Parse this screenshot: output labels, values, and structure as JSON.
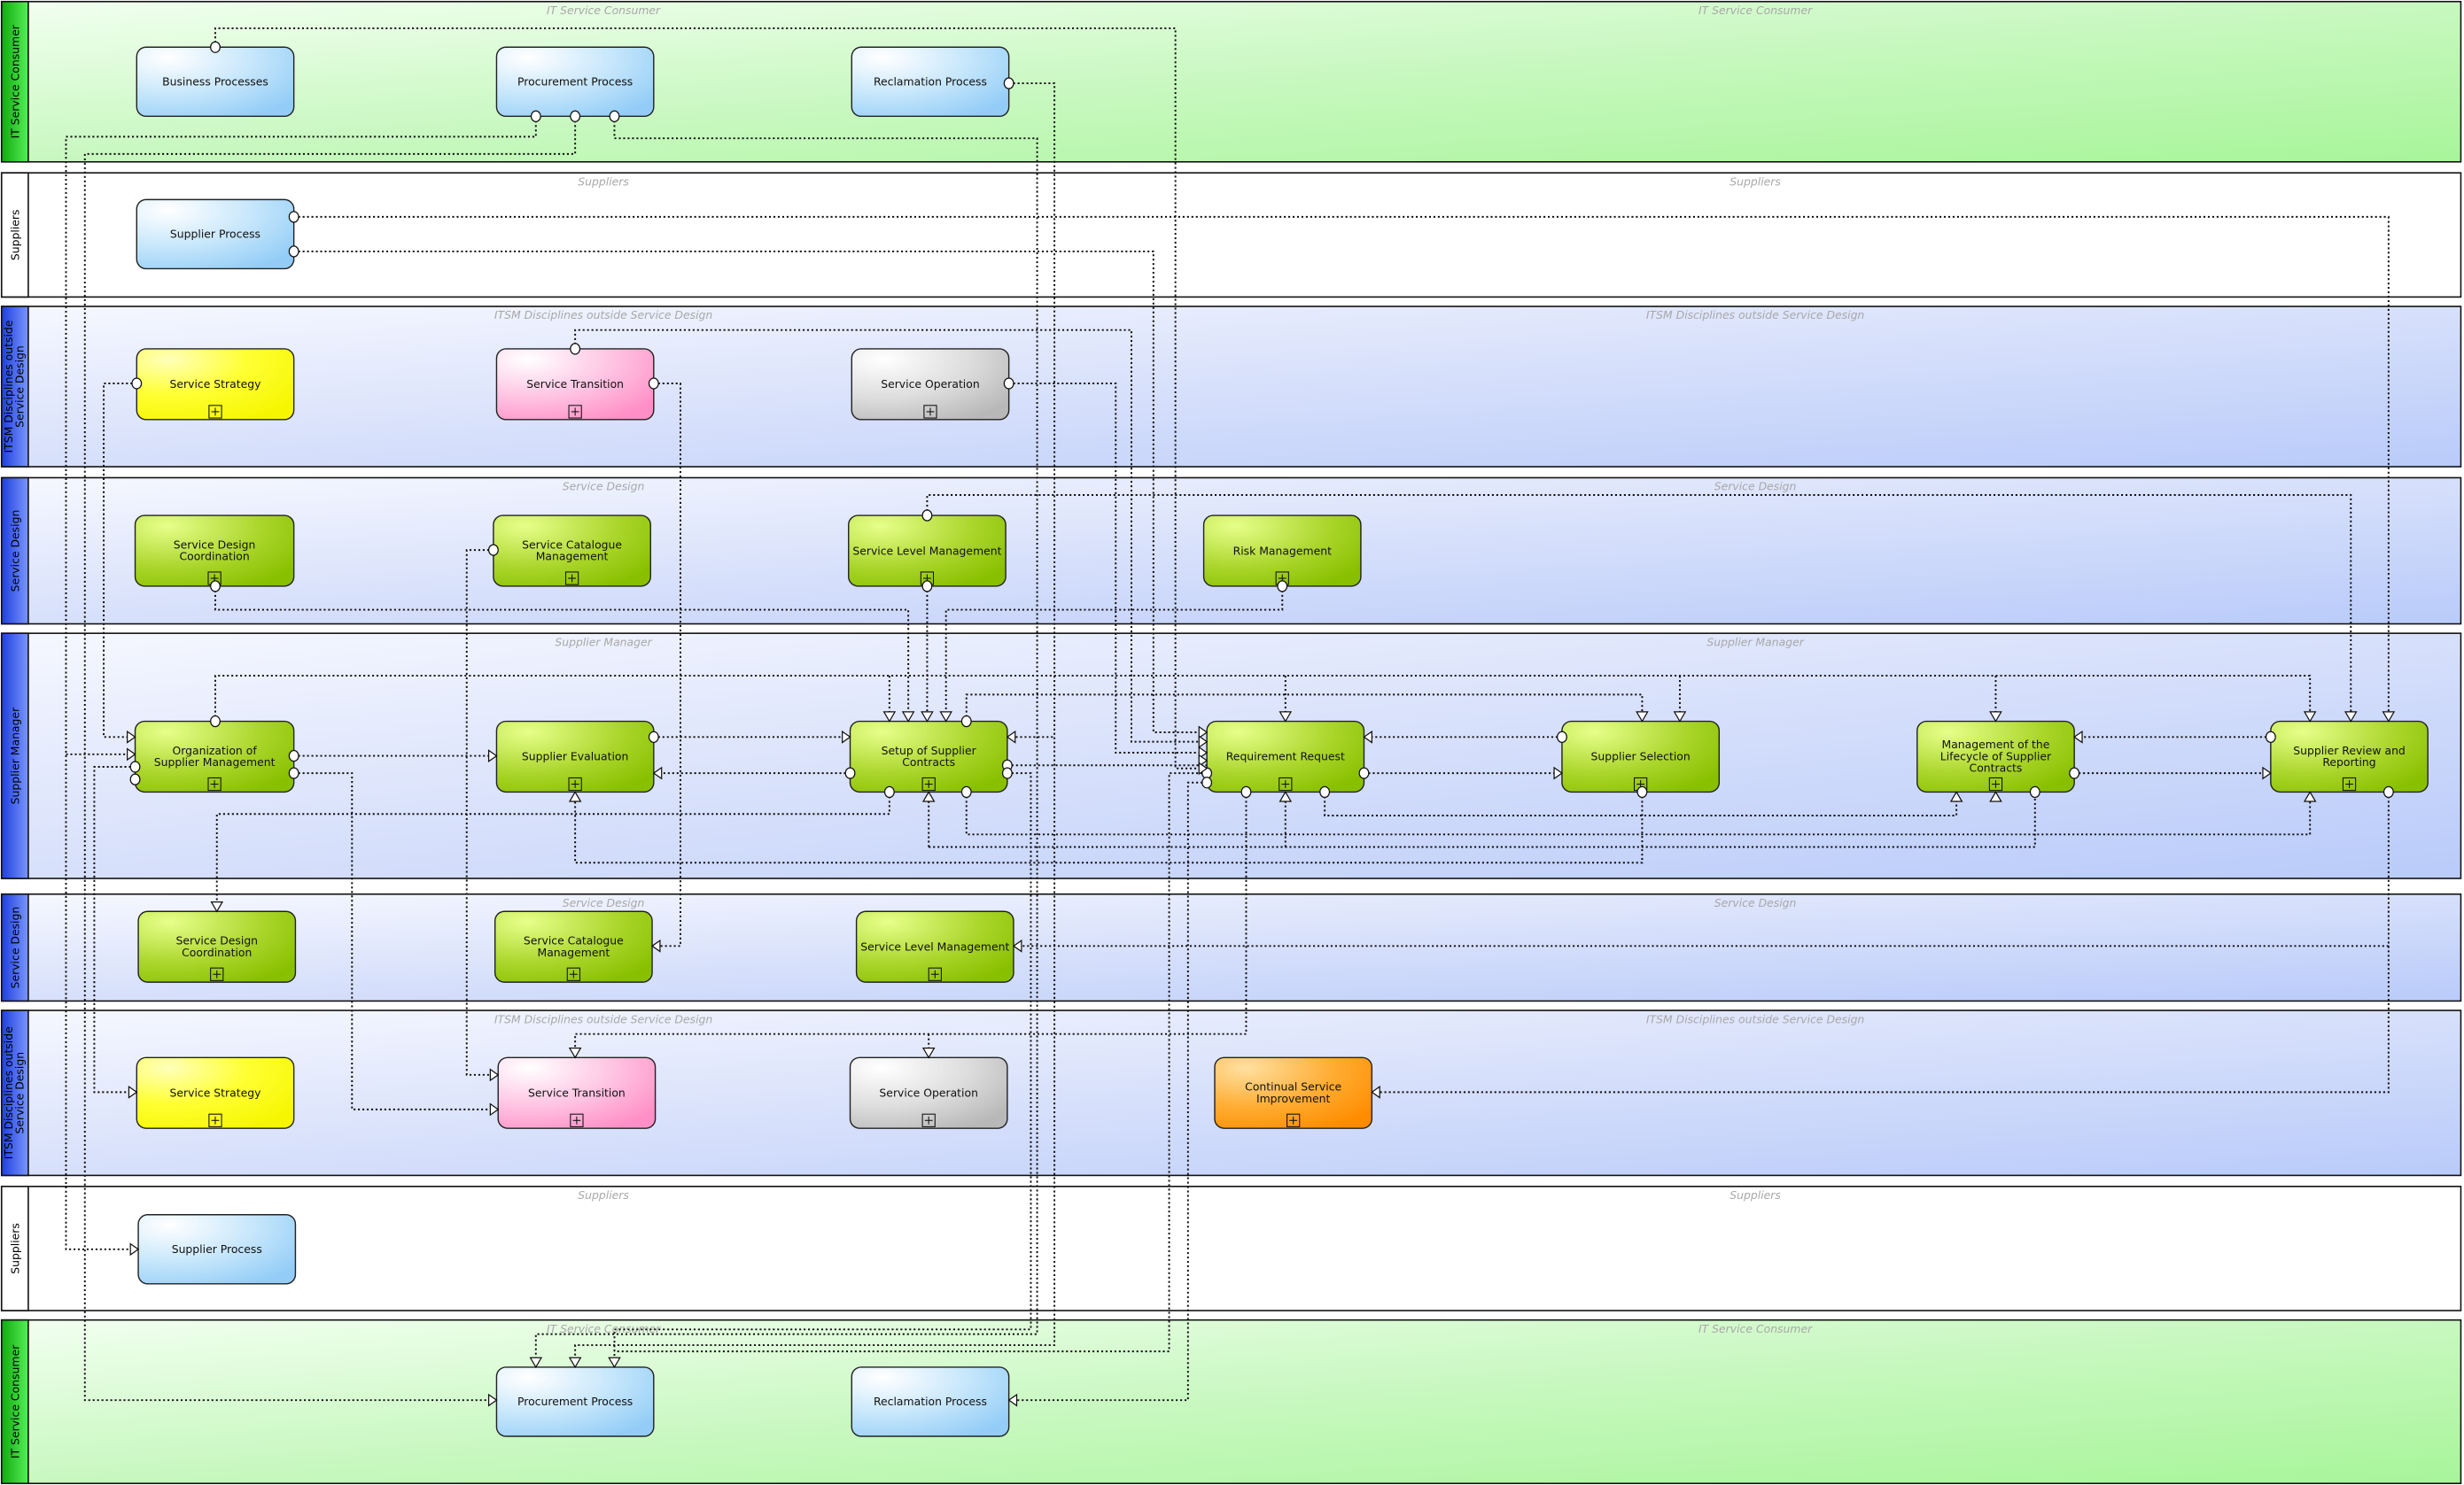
{
  "diagram": {
    "colors": {
      "consumer_lane": "#b3f5a8",
      "consumer_header": "#22cc22",
      "blue_lane": "#c2d2fb",
      "blue_header": "#3355ee",
      "white_lane": "#ffffff",
      "process_blue": "#a9d7f8",
      "green_activity": "#99cc00",
      "strategy_yellow": "#ffff00",
      "transition_pink": "#ff99cc",
      "operation_grey": "#c8c8c8",
      "csi_orange": "#ff9900"
    },
    "lanes": [
      {
        "id": "consumer-top",
        "label": "IT Service Consumer",
        "title": "IT Service Consumer",
        "title2": "IT Service Consumer"
      },
      {
        "id": "suppliers-top",
        "label": "Suppliers",
        "title": "Suppliers",
        "title2": "Suppliers"
      },
      {
        "id": "itsm-top",
        "label": "ITSM Disciplines outside Service Design",
        "title": "ITSM Disciplines outside Service Design",
        "title2": "ITSM Disciplines outside Service Design"
      },
      {
        "id": "sd-top",
        "label": "Service Design",
        "title": "Service Design",
        "title2": "Service Design"
      },
      {
        "id": "supplier-manager",
        "label": "Supplier Manager",
        "title": "Supplier Manager",
        "title2": "Supplier Manager"
      },
      {
        "id": "sd-bottom",
        "label": "Service Design",
        "title": "Service Design",
        "title2": "Service Design"
      },
      {
        "id": "itsm-bottom",
        "label": "ITSM Disciplines outside Service Design",
        "title": "ITSM Disciplines outside Service Design",
        "title2": "ITSM Disciplines outside Service Design"
      },
      {
        "id": "suppliers-bottom",
        "label": "Suppliers",
        "title": "Suppliers",
        "title2": "Suppliers"
      },
      {
        "id": "consumer-bottom",
        "label": "IT Service Consumer",
        "title": "IT Service Consumer",
        "title2": "IT Service Consumer"
      }
    ],
    "nodes": [
      {
        "id": "business-processes",
        "label": "Business Processes",
        "kind": "process"
      },
      {
        "id": "procurement-process-top",
        "label": "Procurement Process",
        "kind": "process"
      },
      {
        "id": "reclamation-process-top",
        "label": "Reclamation Process",
        "kind": "process"
      },
      {
        "id": "supplier-process-top",
        "label": "Supplier Process",
        "kind": "process"
      },
      {
        "id": "service-strategy-top",
        "label": "Service Strategy",
        "kind": "strategy"
      },
      {
        "id": "service-transition-top",
        "label": "Service Transition",
        "kind": "transition"
      },
      {
        "id": "service-operation-top",
        "label": "Service Operation",
        "kind": "operation"
      },
      {
        "id": "sdc-top",
        "label": "Service Design Coordination",
        "kind": "activity"
      },
      {
        "id": "scm-top",
        "label": "Service Catalogue Management",
        "kind": "activity"
      },
      {
        "id": "slm-top",
        "label": "Service Level Management",
        "kind": "activity"
      },
      {
        "id": "risk-management",
        "label": "Risk Management",
        "kind": "activity"
      },
      {
        "id": "org-supplier-mgmt",
        "label": "Organization of Supplier Management",
        "kind": "activity"
      },
      {
        "id": "supplier-evaluation",
        "label": "Supplier Evaluation",
        "kind": "activity"
      },
      {
        "id": "setup-supplier-contracts",
        "label": "Setup of Supplier Contracts",
        "kind": "activity"
      },
      {
        "id": "requirement-request",
        "label": "Requirement Request",
        "kind": "activity"
      },
      {
        "id": "supplier-selection",
        "label": "Supplier Selection",
        "kind": "activity"
      },
      {
        "id": "lifecycle-mgmt",
        "label": "Management of the Lifecycle of Supplier Contracts",
        "kind": "activity"
      },
      {
        "id": "supplier-review",
        "label": "Supplier Review and Reporting",
        "kind": "activity"
      },
      {
        "id": "sdc-bottom",
        "label": "Service Design Coordination",
        "kind": "activity"
      },
      {
        "id": "scm-bottom",
        "label": "Service Catalogue Management",
        "kind": "activity"
      },
      {
        "id": "slm-bottom",
        "label": "Service Level Management",
        "kind": "activity"
      },
      {
        "id": "service-strategy-bottom",
        "label": "Service Strategy",
        "kind": "strategy"
      },
      {
        "id": "service-transition-bottom",
        "label": "Service Transition",
        "kind": "transition"
      },
      {
        "id": "service-operation-bottom",
        "label": "Service Operation",
        "kind": "operation"
      },
      {
        "id": "csi",
        "label": "Continual Service Improvement",
        "kind": "csi"
      },
      {
        "id": "supplier-process-bottom",
        "label": "Supplier Process",
        "kind": "process"
      },
      {
        "id": "procurement-process-bottom",
        "label": "Procurement Process",
        "kind": "process"
      },
      {
        "id": "reclamation-process-bottom",
        "label": "Reclamation Process",
        "kind": "process"
      }
    ]
  }
}
